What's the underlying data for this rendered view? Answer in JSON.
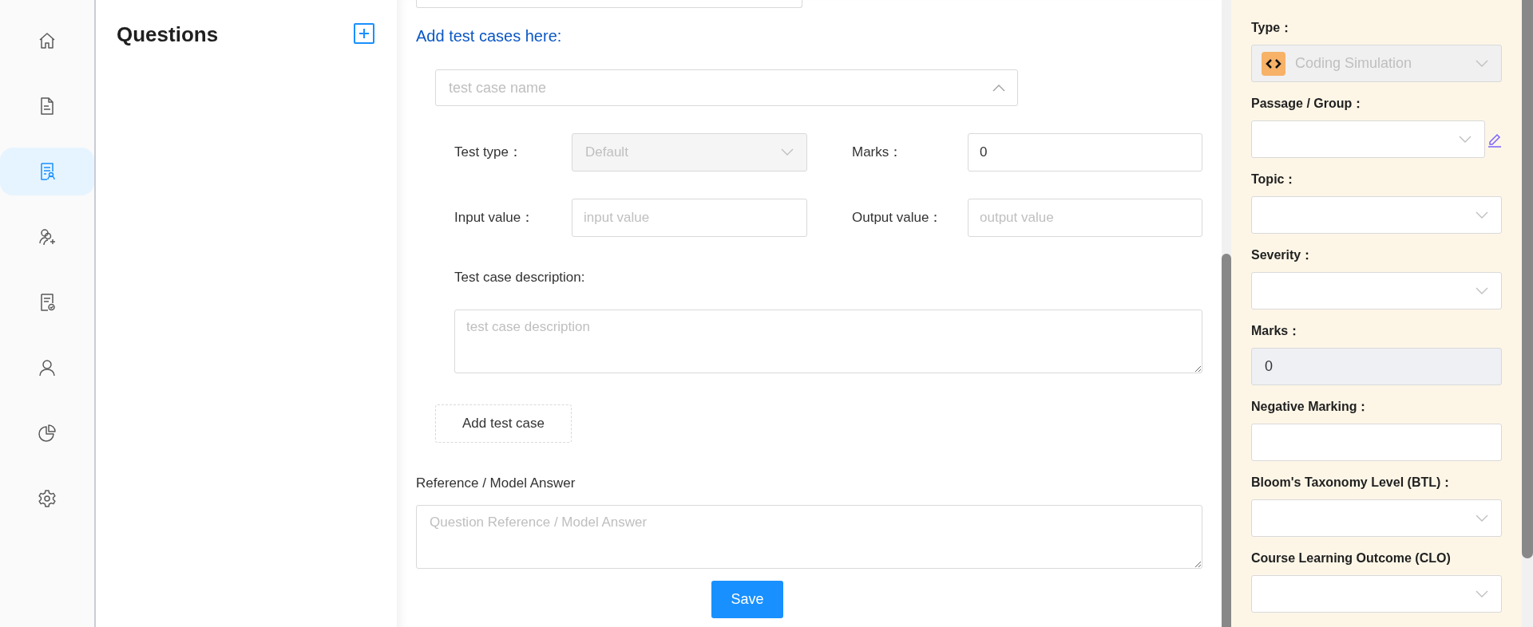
{
  "nav": {
    "items": [
      {
        "kind": "home",
        "selected": false
      },
      {
        "kind": "document",
        "selected": false
      },
      {
        "kind": "document-person",
        "selected": true
      },
      {
        "kind": "person-add",
        "selected": false
      },
      {
        "kind": "document-check",
        "selected": false
      },
      {
        "kind": "person",
        "selected": false
      },
      {
        "kind": "pie-chart",
        "selected": false
      },
      {
        "kind": "settings",
        "selected": false
      }
    ]
  },
  "questions_panel": {
    "title": "Questions"
  },
  "test_cases": {
    "heading": "Add test cases here:",
    "name_placeholder": "test case name",
    "expanded": true,
    "test_type": {
      "label": "Test type：",
      "value": "Default",
      "disabled": true
    },
    "marks": {
      "label": "Marks：",
      "value": "0"
    },
    "input_value": {
      "label": "Input value：",
      "placeholder": "input value"
    },
    "output_value": {
      "label": "Output value：",
      "placeholder": "output value"
    },
    "description": {
      "label": "Test case description:",
      "placeholder": "test case description"
    },
    "add_button": "Add test case"
  },
  "reference": {
    "label": "Reference / Model Answer",
    "placeholder": "Question Reference / Model Answer"
  },
  "save_button": "Save",
  "properties": {
    "fields": [
      {
        "kind": "select",
        "label": "Type：",
        "value": "Coding Simulation",
        "disabled": true,
        "icon": true
      },
      {
        "kind": "select",
        "label": "Passage / Group：",
        "disabled": false,
        "editable": true
      },
      {
        "kind": "select",
        "label": "Topic：",
        "disabled": false
      },
      {
        "kind": "select",
        "label": "Severity：",
        "disabled": false
      },
      {
        "kind": "input",
        "label": "Marks：",
        "value": "0",
        "disabled": true
      },
      {
        "kind": "input",
        "label": "Negative Marking：",
        "disabled": false
      },
      {
        "kind": "select",
        "label": "Bloom's Taxonomy Level (BTL)：",
        "disabled": false
      },
      {
        "kind": "select",
        "label": "Course Learning Outcome (CLO)",
        "disabled": false
      }
    ]
  }
}
